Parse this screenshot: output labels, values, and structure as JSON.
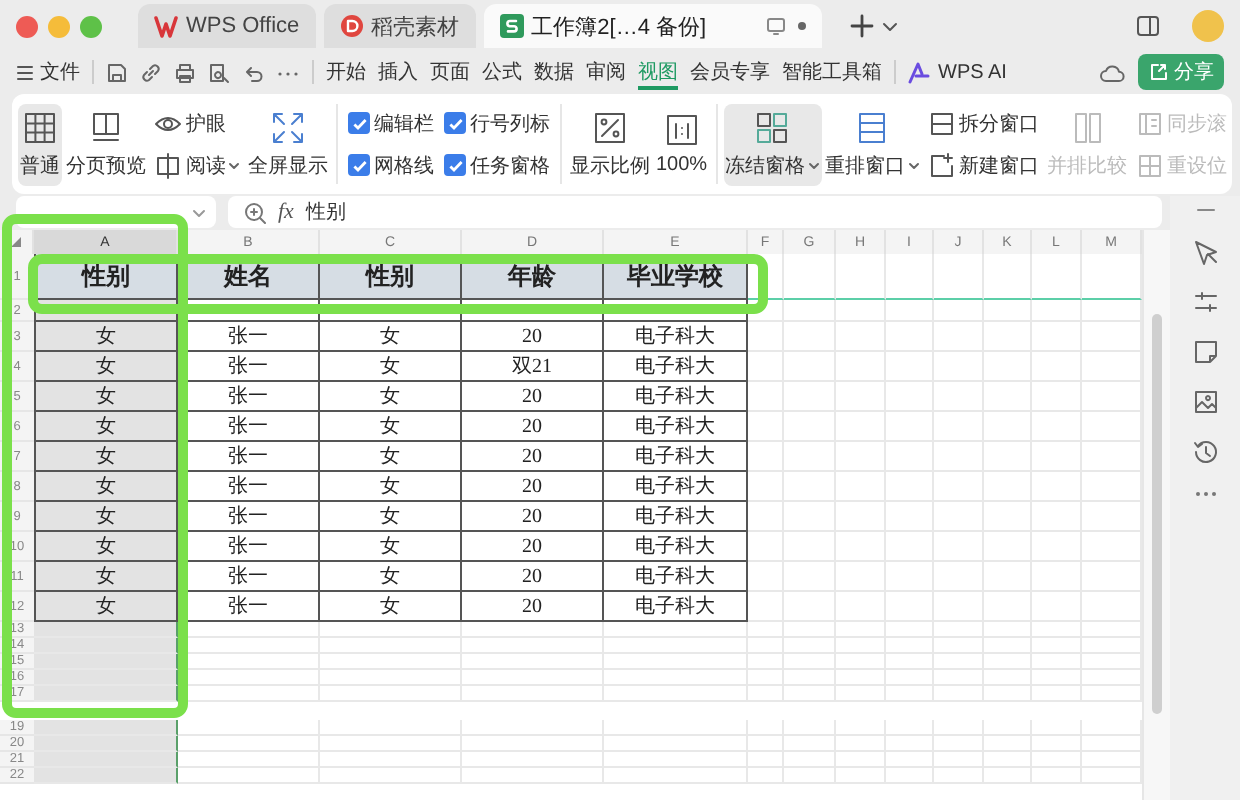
{
  "title_bar": {
    "tabs": [
      {
        "kind": "wps",
        "label": "WPS Office",
        "selected": false
      },
      {
        "kind": "daoke",
        "label": "稻壳素材",
        "selected": false
      },
      {
        "kind": "sheet",
        "label": "工作簿2[…4 备份]",
        "selected": true
      }
    ]
  },
  "menu": {
    "file": "文件",
    "tabs": [
      {
        "label": "开始",
        "selected": false
      },
      {
        "label": "插入",
        "selected": false
      },
      {
        "label": "页面",
        "selected": false
      },
      {
        "label": "公式",
        "selected": false
      },
      {
        "label": "数据",
        "selected": false
      },
      {
        "label": "审阅",
        "selected": false
      },
      {
        "label": "视图",
        "selected": true
      },
      {
        "label": "会员专享",
        "selected": false
      },
      {
        "label": "智能工具箱",
        "selected": false
      }
    ],
    "ai": "WPS AI",
    "share": "分享"
  },
  "ribbon": {
    "groups": [
      {
        "items": [
          {
            "kind": "big",
            "label": "普通",
            "selected": true,
            "dropdown": false,
            "disabled": false
          },
          {
            "kind": "big",
            "label": "分页预览",
            "selected": false,
            "dropdown": false,
            "disabled": false
          },
          {
            "kind": "pair",
            "items": [
              {
                "kind": "button",
                "label": "护眼",
                "dropdown": false,
                "disabled": false
              },
              {
                "kind": "button",
                "label": "阅读",
                "dropdown": true,
                "disabled": false
              }
            ]
          },
          {
            "kind": "big",
            "label": "全屏显示",
            "selected": false,
            "dropdown": false,
            "disabled": false
          }
        ]
      },
      {
        "items": [
          {
            "kind": "pair",
            "items": [
              {
                "kind": "check",
                "label": "编辑栏",
                "checked": true
              },
              {
                "kind": "check",
                "label": "网格线",
                "checked": true
              }
            ]
          },
          {
            "kind": "pair",
            "items": [
              {
                "kind": "check",
                "label": "行号列标",
                "checked": true
              },
              {
                "kind": "check",
                "label": "任务窗格",
                "checked": true
              }
            ]
          }
        ]
      },
      {
        "items": [
          {
            "kind": "big",
            "label": "显示比例",
            "selected": false,
            "dropdown": false,
            "disabled": false
          },
          {
            "kind": "big",
            "label": "100%",
            "selected": false,
            "dropdown": false,
            "disabled": false
          }
        ]
      },
      {
        "items": [
          {
            "kind": "big",
            "label": "冻结窗格",
            "selected": true,
            "dropdown": true,
            "disabled": false
          },
          {
            "kind": "big",
            "label": "重排窗口",
            "selected": false,
            "dropdown": true,
            "disabled": false
          },
          {
            "kind": "pair",
            "items": [
              {
                "kind": "button",
                "label": "拆分窗口",
                "dropdown": false,
                "disabled": false
              },
              {
                "kind": "button",
                "label": "新建窗口",
                "dropdown": false,
                "disabled": false
              }
            ]
          },
          {
            "kind": "big",
            "label": "并排比较",
            "selected": false,
            "dropdown": false,
            "disabled": true
          },
          {
            "kind": "pair",
            "items": [
              {
                "kind": "button",
                "label": "同步滚",
                "dropdown": false,
                "disabled": true
              },
              {
                "kind": "button",
                "label": "重设位",
                "dropdown": false,
                "disabled": true
              }
            ]
          }
        ]
      }
    ]
  },
  "formula_bar": {
    "function_label": "fx",
    "value": "性别"
  },
  "sheet": {
    "columns": [
      {
        "letter": "A",
        "selected": true
      },
      {
        "letter": "B",
        "selected": false
      },
      {
        "letter": "C",
        "selected": false
      },
      {
        "letter": "D",
        "selected": false
      },
      {
        "letter": "E",
        "selected": false
      },
      {
        "letter": "F",
        "selected": false
      },
      {
        "letter": "G",
        "selected": false
      },
      {
        "letter": "H",
        "selected": false
      },
      {
        "letter": "I",
        "selected": false
      },
      {
        "letter": "J",
        "selected": false
      },
      {
        "letter": "K",
        "selected": false
      },
      {
        "letter": "L",
        "selected": false
      },
      {
        "letter": "M",
        "selected": false
      }
    ],
    "rows": [
      {
        "number": "1",
        "kind": "header",
        "cells": [
          "性别",
          "姓名",
          "性别",
          "年龄",
          "毕业学校"
        ]
      },
      {
        "number": "2",
        "kind": "blank"
      },
      {
        "number": "3",
        "kind": "data",
        "cells": [
          "女",
          "张一",
          "女",
          "20",
          "电子科大"
        ]
      },
      {
        "number": "4",
        "kind": "data",
        "cells": [
          "女",
          "张一",
          "女",
          "双21",
          "电子科大"
        ]
      },
      {
        "number": "5",
        "kind": "data",
        "cells": [
          "女",
          "张一",
          "女",
          "20",
          "电子科大"
        ]
      },
      {
        "number": "6",
        "kind": "data",
        "cells": [
          "女",
          "张一",
          "女",
          "20",
          "电子科大"
        ]
      },
      {
        "number": "7",
        "kind": "data",
        "cells": [
          "女",
          "张一",
          "女",
          "20",
          "电子科大"
        ]
      },
      {
        "number": "8",
        "kind": "data",
        "cells": [
          "女",
          "张一",
          "女",
          "20",
          "电子科大"
        ]
      },
      {
        "number": "9",
        "kind": "data",
        "cells": [
          "女",
          "张一",
          "女",
          "20",
          "电子科大"
        ]
      },
      {
        "number": "10",
        "kind": "data",
        "cells": [
          "女",
          "张一",
          "女",
          "20",
          "电子科大"
        ]
      },
      {
        "number": "11",
        "kind": "data",
        "cells": [
          "女",
          "张一",
          "女",
          "20",
          "电子科大"
        ]
      },
      {
        "number": "12",
        "kind": "data",
        "cells": [
          "女",
          "张一",
          "女",
          "20",
          "电子科大"
        ]
      },
      {
        "number": "13",
        "kind": "empty"
      },
      {
        "number": "14",
        "kind": "empty"
      },
      {
        "number": "15",
        "kind": "empty"
      },
      {
        "number": "16",
        "kind": "empty"
      },
      {
        "number": "17",
        "kind": "empty"
      },
      {
        "kind": "empty"
      },
      {
        "number": "19",
        "kind": "empty"
      },
      {
        "number": "20",
        "kind": "empty"
      },
      {
        "number": "21",
        "kind": "empty"
      },
      {
        "number": "22",
        "kind": "empty"
      },
      {
        "kind": "empty"
      }
    ]
  }
}
